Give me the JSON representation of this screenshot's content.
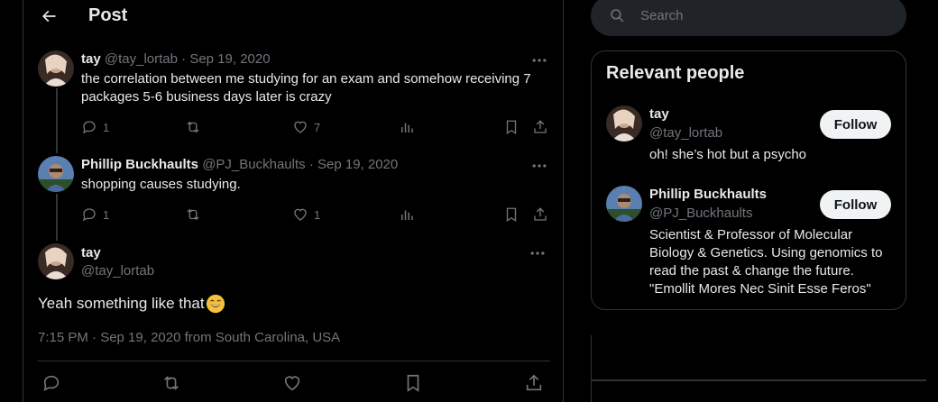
{
  "header": {
    "title": "Post"
  },
  "thread": [
    {
      "name": "tay",
      "handle": "@tay_lortab",
      "sep": "·",
      "date": "Sep 19, 2020",
      "text": "the correlation between me studying for an exam and somehow receiving 7 packages 5-6 business days later is crazy",
      "replies": "1",
      "reposts": "",
      "likes": "7"
    },
    {
      "name": "Phillip Buckhaults",
      "handle": "@PJ_Buckhaults",
      "sep": "·",
      "date": "Sep 19, 2020",
      "text": "shopping causes studying.",
      "replies": "1",
      "reposts": "",
      "likes": "1"
    }
  ],
  "focus": {
    "name": "tay",
    "handle": "@tay_lortab",
    "text": "Yeah something like that",
    "emoji_icon": "grinning-sweat-emoji",
    "meta": "7:15 PM · Sep 19, 2020 from South Carolina, USA"
  },
  "search": {
    "placeholder": "Search"
  },
  "relevant_people": {
    "title": "Relevant people",
    "follow_label": "Follow",
    "people": [
      {
        "name": "tay",
        "handle": "@tay_lortab",
        "bio": "oh! she’s hot but a psycho"
      },
      {
        "name": "Phillip Buckhaults",
        "handle": "@PJ_Buckhaults",
        "bio": "Scientist & Professor of Molecular Biology & Genetics. Using genomics to read the past & change the future. \"Emollit Mores Nec Sinit Esse Feros\""
      }
    ]
  },
  "colors": {
    "background": "#000000",
    "text": "#e7e9ea",
    "muted": "#71767b",
    "border": "#2f3336",
    "follow_bg": "#eff3f4"
  }
}
